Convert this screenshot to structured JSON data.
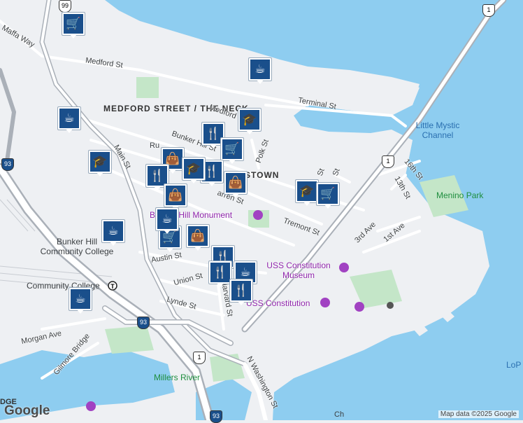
{
  "map": {
    "water_color": "#8ecdf0",
    "land_color": "#eef0f3",
    "park_color": "#c4e6c8",
    "road_color": "#ffffff",
    "highway_color": "#aab0b8",
    "marker_color": "#1a4f8b"
  },
  "areas": {
    "medford_street_neck": "MEDFORD STREET / THE NECK",
    "charlestown_partial": "STOWN"
  },
  "water": {
    "little_mystic_channel": "Little Mystic Channel"
  },
  "parks": {
    "menino_park": "Menino Park",
    "millers_river": "Millers River"
  },
  "pois": {
    "bunker_hill_monument": "Bunker Hill Monument",
    "uss_constitution_museum": "USS Constitution Museum",
    "uss_constitution": "USS Constitution",
    "bunker_hill_cc": "Bunker Hill Community College",
    "community_college_station": "Community College"
  },
  "roads": {
    "maffa_way": "Maffa Way",
    "medford_st": "Medford St",
    "medford_st_2": "Medford St",
    "terminal_st": "Terminal St",
    "bunker_hill_st": "Bunker Hill St",
    "main_st": "Main St",
    "polk_st": "Polk St",
    "tremont_st": "Tremont St",
    "austin_st": "Austin St",
    "union_st": "Union St",
    "lynde_st": "Lynde St",
    "harvard_st": "Harvard St",
    "morgan_ave": "Morgan Ave",
    "gilmore_bridge": "Gilmore Bridge",
    "n_washington_st": "N Washington St",
    "3rd_ave": "3rd Ave",
    "1st_ave": "1st Ave",
    "16th_st": "16th St",
    "13th_st": "13th St",
    "st_a": "St",
    "st_b": "St",
    "ru_partial": "Ru",
    "warren_partial": "arren St"
  },
  "shields": {
    "rt1_top": "1",
    "rt1_mid": "1",
    "rt1_bottom": "1",
    "rt99": "99",
    "i93_a": "93",
    "i93_b": "93",
    "i93_c": "93"
  },
  "markers": [
    {
      "icon": "shopping-cart-icon",
      "glyph": "🛒"
    },
    {
      "icon": "coffee-cup-icon",
      "glyph": "☕"
    },
    {
      "icon": "graduation-cap-icon",
      "glyph": "🎓"
    },
    {
      "icon": "coffee-cup-icon",
      "glyph": "☕"
    },
    {
      "icon": "graduation-cap-icon",
      "glyph": "🎓"
    },
    {
      "icon": "restaurant-icon",
      "glyph": "🍴"
    },
    {
      "icon": "shopping-cart-icon",
      "glyph": "🛒"
    },
    {
      "icon": "shopping-bag-icon",
      "glyph": "👜"
    },
    {
      "icon": "restaurant-icon",
      "glyph": "🍴"
    },
    {
      "icon": "restaurant-icon",
      "glyph": "🍴"
    },
    {
      "icon": "graduation-cap-icon",
      "glyph": "🎓"
    },
    {
      "icon": "shopping-bag-icon",
      "glyph": "👜"
    },
    {
      "icon": "graduation-cap-icon",
      "glyph": "🎓"
    },
    {
      "icon": "shopping-cart-icon",
      "glyph": "🛒"
    },
    {
      "icon": "shopping-bag-icon",
      "glyph": "👜"
    },
    {
      "icon": "shopping-cart-icon",
      "glyph": "🛒"
    },
    {
      "icon": "shopping-bag-icon",
      "glyph": "👜"
    },
    {
      "icon": "coffee-cup-icon",
      "glyph": "☕"
    },
    {
      "icon": "restaurant-icon",
      "glyph": "🍴"
    },
    {
      "icon": "coffee-cup-icon",
      "glyph": "☕"
    },
    {
      "icon": "restaurant-icon",
      "glyph": "🍴"
    },
    {
      "icon": "restaurant-icon",
      "glyph": "🍴"
    },
    {
      "icon": "coffee-cup-icon",
      "glyph": "☕"
    },
    {
      "icon": "coffee-cup-icon",
      "glyph": "☕"
    }
  ],
  "attribution": "Map data ©2025 Google",
  "logo": "Google",
  "edge_labels": {
    "lop": "LoP",
    "dge": "DGE",
    "ch": "Ch"
  }
}
